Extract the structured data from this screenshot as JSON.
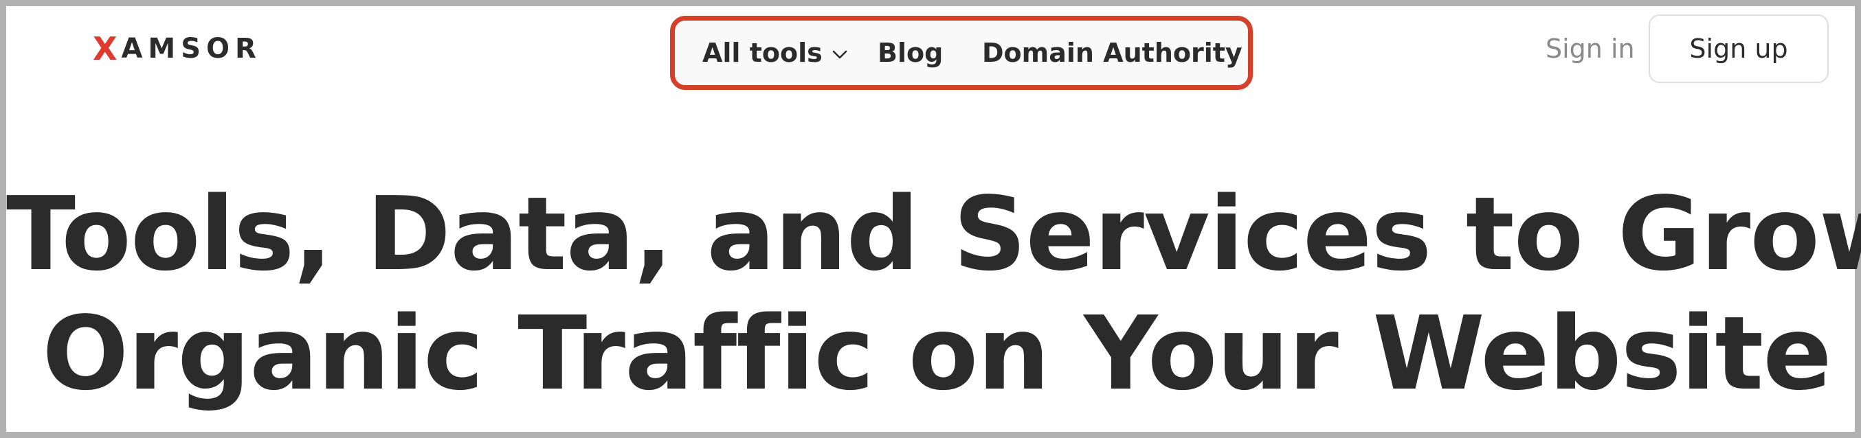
{
  "brand": {
    "logo_accent": "X",
    "logo_rest": "AMSOR",
    "accent_color": "#e03a2f"
  },
  "nav": {
    "highlight_color": "#d6402a",
    "items": [
      {
        "label": "All tools",
        "has_dropdown": true,
        "icon": "chevron-down-icon"
      },
      {
        "label": "Blog"
      },
      {
        "label": "Domain Authority"
      }
    ]
  },
  "actions": {
    "sign_in": "Sign in",
    "sign_up": "Sign up"
  },
  "hero": {
    "line1": "Tools, Data, and Services to Grow",
    "line2": "Organic Traffic on Your Website"
  }
}
